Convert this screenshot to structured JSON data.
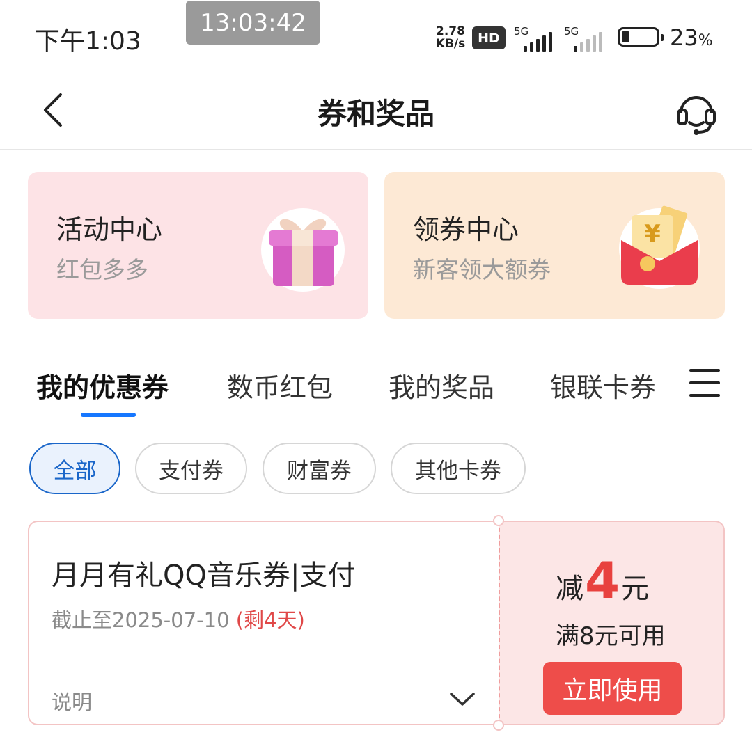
{
  "status_bar": {
    "time": "下午1:03",
    "clock_overlay": "13:03:42",
    "net_speed_value": "2.78",
    "net_speed_unit": "KB/s",
    "hd_badge": "HD",
    "signal1_label": "5G",
    "signal2_label": "5G",
    "battery_level": 0.23,
    "battery_percent": "23",
    "battery_percent_sign": "%"
  },
  "header": {
    "title": "券和奖品",
    "back_icon": "chevron-left-icon",
    "support_icon": "headset-icon"
  },
  "promo_cards": [
    {
      "title": "活动中心",
      "subtitle": "红包多多",
      "icon": "gift-box-icon"
    },
    {
      "title": "领券中心",
      "subtitle": "新客领大额券",
      "icon": "red-envelope-icon"
    }
  ],
  "tabs": {
    "items": [
      "我的优惠券",
      "数币红包",
      "我的奖品",
      "银联卡券"
    ],
    "active_index": 0,
    "menu_icon": "menu-icon",
    "active_color": "#1677ff"
  },
  "filters": {
    "items": [
      "全部",
      "支付券",
      "财富券",
      "其他卡券"
    ],
    "active_index": 0
  },
  "coupon": {
    "title": "月月有礼QQ音乐券|支付",
    "expiry": "截止至2025-07-10",
    "remaining": "(剩4天)",
    "note_label": "说明",
    "discount_prefix": "减",
    "discount_amount": "4",
    "discount_unit": "元",
    "condition": "满8元可用",
    "use_button": "立即使用",
    "accent_color": "#e8413e"
  }
}
